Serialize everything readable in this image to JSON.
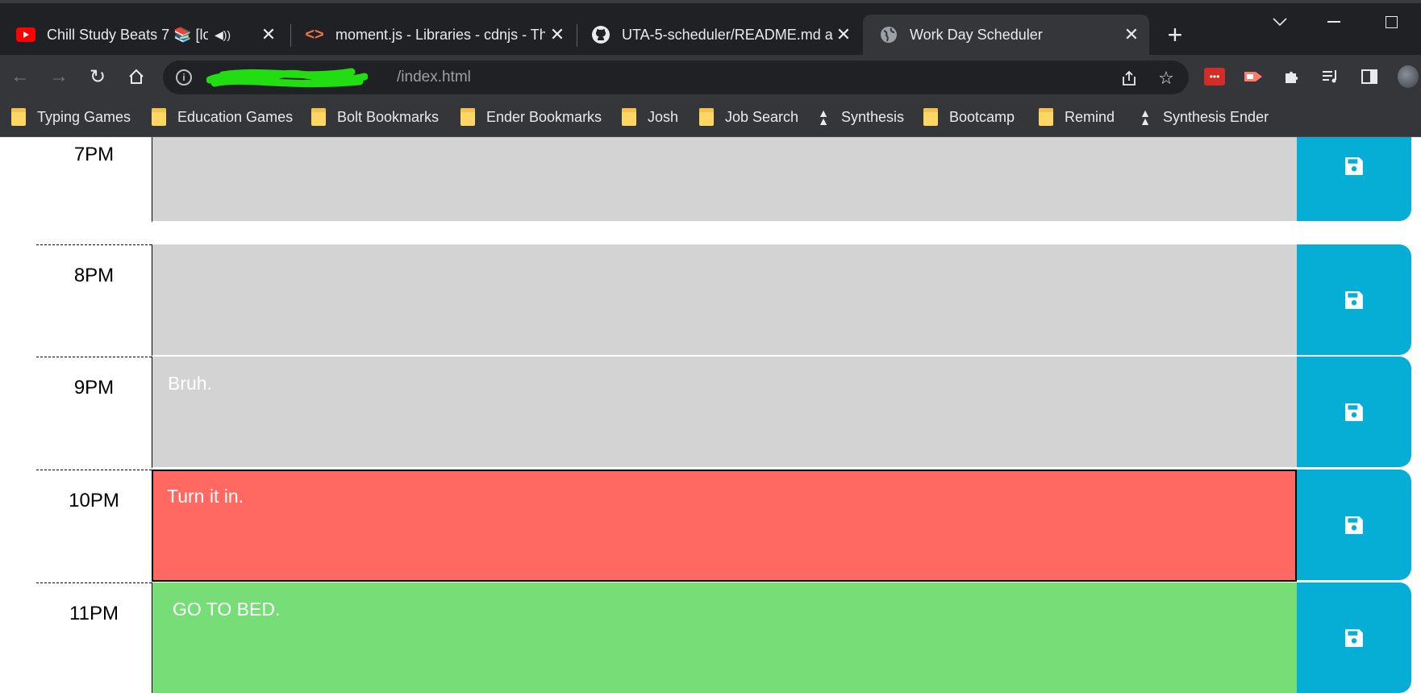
{
  "browser": {
    "tabs": [
      {
        "title": "Chill Study Beats 7 📚 [lofi h",
        "icon": "youtube-icon",
        "audio": true
      },
      {
        "title": "moment.js - Libraries - cdnjs - Th",
        "icon": "cdnjs-icon"
      },
      {
        "title": "UTA-5-scheduler/README.md at",
        "icon": "github-icon"
      },
      {
        "title": "Work Day Scheduler",
        "icon": "globe-icon",
        "active": true
      }
    ],
    "address": {
      "url": "/index.html"
    },
    "bookmarks": [
      {
        "label": "Typing Games",
        "type": "folder"
      },
      {
        "label": "Education Games",
        "type": "folder"
      },
      {
        "label": "Bolt Bookmarks",
        "type": "folder"
      },
      {
        "label": "Ender Bookmarks",
        "type": "folder"
      },
      {
        "label": "Josh",
        "type": "folder"
      },
      {
        "label": "Job Search",
        "type": "folder"
      },
      {
        "label": "Synthesis",
        "type": "link"
      },
      {
        "label": "Bootcamp",
        "type": "folder"
      },
      {
        "label": "Remind",
        "type": "folder"
      },
      {
        "label": "Synthesis Ender",
        "type": "link"
      }
    ]
  },
  "scheduler": {
    "rows": [
      {
        "hour": "7PM",
        "text": "",
        "state": "past"
      },
      {
        "hour": "8PM",
        "text": "",
        "state": "past"
      },
      {
        "hour": "9PM",
        "text": "Bruh.",
        "state": "past"
      },
      {
        "hour": "10PM",
        "text": "Turn it in.",
        "state": "present"
      },
      {
        "hour": "11PM",
        "text": "GO TO BED.",
        "state": "future"
      }
    ],
    "colors": {
      "past": "#d3d3d3",
      "present": "#ff6961",
      "future": "#77dd77",
      "save": "#06aed5"
    }
  }
}
